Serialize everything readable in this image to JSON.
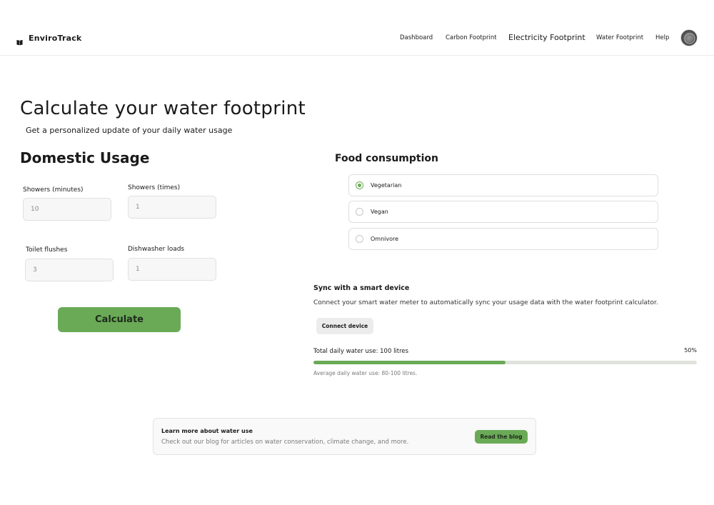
{
  "app": {
    "name": "EnviroTrack",
    "logo_icon": "book-icon"
  },
  "nav": {
    "links": [
      {
        "label": "Dashboard"
      },
      {
        "label": "Carbon Footprint"
      },
      {
        "label": "Electricity Footprint"
      },
      {
        "label": "Water Footprint"
      },
      {
        "label": "Help"
      }
    ],
    "avatar_icon": "user-avatar"
  },
  "hero": {
    "title": "Calculate your water footprint",
    "subtitle": "Get a personalized update of your daily water usage"
  },
  "domestic": {
    "title": "Domestic Usage",
    "fields": [
      {
        "label": "Showers (minutes)",
        "placeholder": "10"
      },
      {
        "label": "Showers (times)",
        "placeholder": "1"
      },
      {
        "label": "Toilet flushes",
        "placeholder": "3"
      },
      {
        "label": "Dishwasher loads",
        "placeholder": "1"
      }
    ],
    "calculate_label": "Calculate"
  },
  "food": {
    "title": "Food consumption",
    "options": [
      {
        "label": "Vegetarian",
        "selected": true
      },
      {
        "label": "Vegan",
        "selected": false
      },
      {
        "label": "Omnivore",
        "selected": false
      }
    ]
  },
  "sync": {
    "title": "Sync with a smart device",
    "description": "Connect your smart water meter to automatically sync your usage data with the water footprint calculator.",
    "button_label": "Connect device"
  },
  "usage": {
    "label": "Total daily water use: 100 litres",
    "percent_label": "50%",
    "percent_value": 50,
    "note": "Average daily water use: 80-100 litres."
  },
  "blog": {
    "title": "Learn more about water use",
    "description": "Check out our blog for articles on water conservation, climate change, and more.",
    "button_label": "Read the blog"
  },
  "colors": {
    "accent": "#6aaa57",
    "track": "#dfe3dc"
  }
}
